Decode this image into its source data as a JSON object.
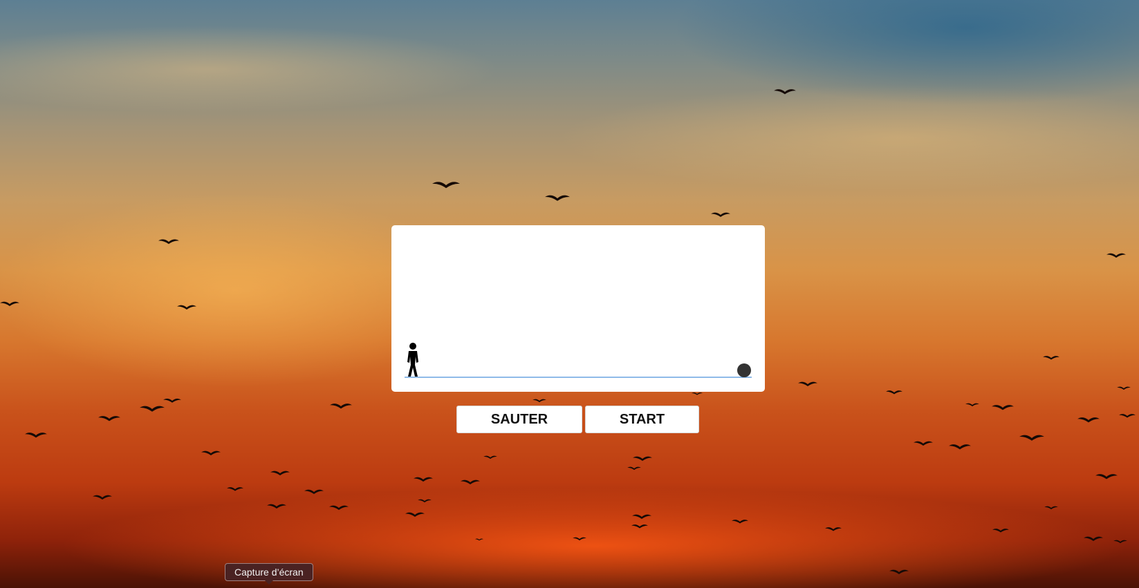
{
  "background": {
    "description_icon": "sunset-sky-with-birds-photo"
  },
  "game": {
    "player_icon": "stick-figure-player-icon",
    "obstacle_icon": "ball-obstacle-icon",
    "ground_color": "#4a90d9",
    "obstacle_color": "#333333"
  },
  "controls": {
    "jump_label": "SAUTER",
    "start_label": "START"
  },
  "tooltip": {
    "label": "Capture d’écran"
  }
}
